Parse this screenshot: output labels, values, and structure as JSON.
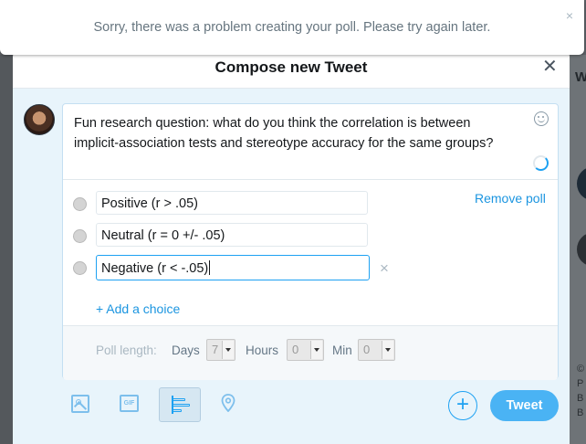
{
  "alert": {
    "message": "Sorry, there was a problem creating your poll. Please try again later.",
    "close_icon": "×"
  },
  "modal": {
    "title": "Compose new Tweet",
    "close_icon": "✕"
  },
  "composer": {
    "tweet_text": "Fun research question: what do you think the correlation is between implicit-association tests and stereotype accuracy for the same groups?"
  },
  "poll": {
    "remove_label": "Remove poll",
    "choices": [
      {
        "value": "Positive (r > .05)"
      },
      {
        "value": "Neutral (r = 0 +/- .05)"
      },
      {
        "value": "Negative (r < -.05)"
      }
    ],
    "remove_choice_icon": "×",
    "add_choice_label": "+ Add a choice",
    "length_label": "Poll length:",
    "days_label": "Days",
    "days_value": "7",
    "hours_label": "Hours",
    "hours_value": "0",
    "min_label": "Min",
    "min_value": "0"
  },
  "toolbar": {
    "icons": [
      "media-icon",
      "gif-icon",
      "poll-icon",
      "location-icon"
    ],
    "gif_text": "GIF",
    "add_icon": "+",
    "tweet_label": "Tweet"
  },
  "background": {
    "side_heading_partial": "W",
    "side_text_lines": [
      "©",
      "P",
      "B",
      "B"
    ]
  },
  "colors": {
    "accent": "#1da1f2",
    "tweet_button": "#4ab3f4",
    "link": "#1b95e0",
    "body_bg": "#e8f4fb"
  }
}
